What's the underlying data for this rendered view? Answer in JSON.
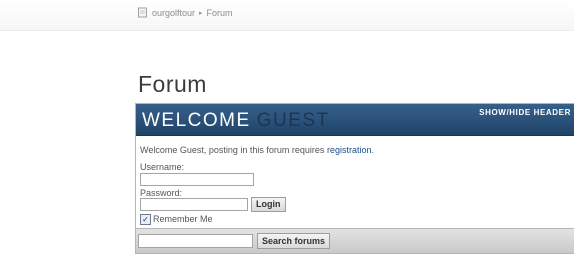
{
  "breadcrumb": {
    "home_icon": "page-icon",
    "site": "ourgolftour",
    "separator": "▸",
    "current": "Forum"
  },
  "page": {
    "title": "Forum"
  },
  "panel": {
    "welcome_word": "WELCOME",
    "welcome_guest": "GUEST",
    "show_hide": "SHOW/HIDE HEADER",
    "intro_text": "Welcome Guest, posting in this forum requires",
    "intro_link": "registration",
    "intro_end": ".",
    "username_label": "Username:",
    "username_value": "",
    "password_label": "Password:",
    "password_value": "",
    "login_button": "Login",
    "remember_label": "Remember Me",
    "remember_checked": true,
    "search_value": "",
    "search_button": "Search forums"
  },
  "colors": {
    "header_blue": "#2a5178",
    "link_blue": "#1d4f8a"
  }
}
